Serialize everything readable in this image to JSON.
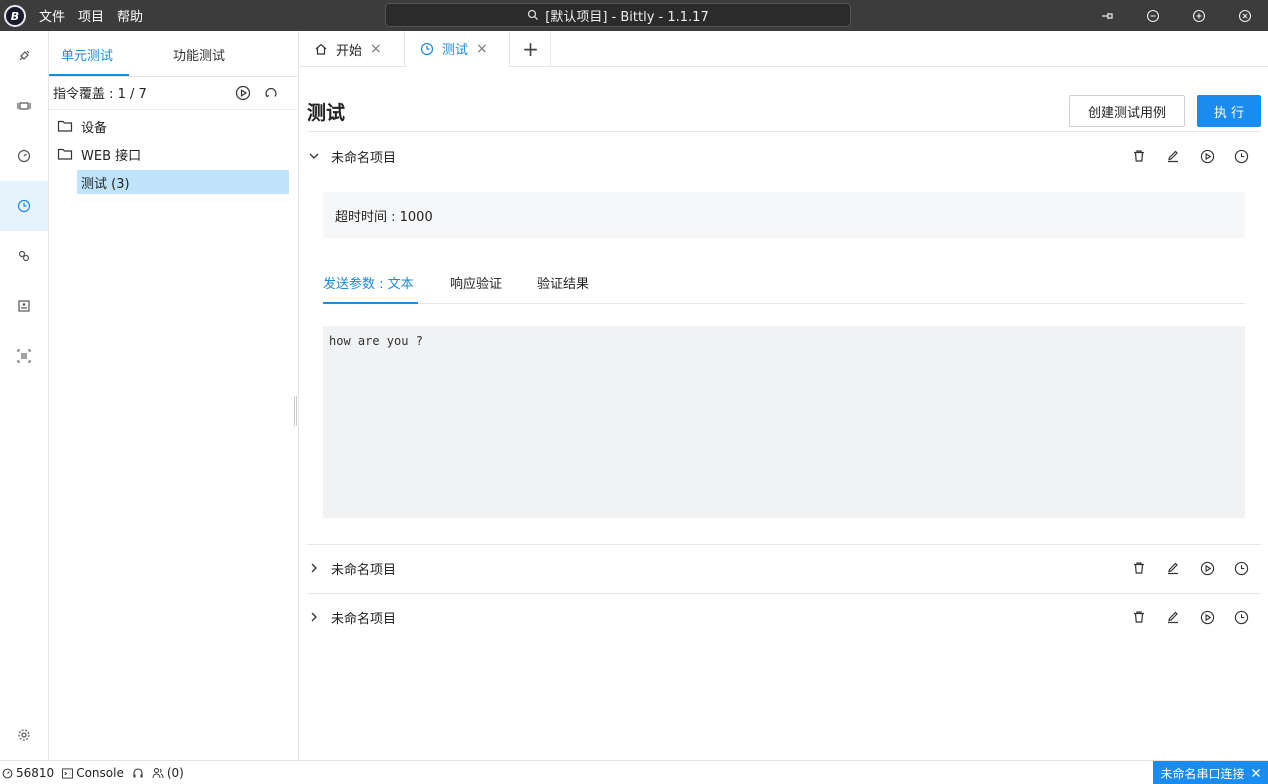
{
  "app": {
    "logo_text": "B",
    "menu": [
      "文件",
      "项目",
      "帮助"
    ],
    "search_title": "[默认项目] - Bittly - 1.1.17"
  },
  "sidebar": {
    "tabs": [
      "单元测试",
      "功能测试"
    ],
    "coverage": "指令覆盖 : 1 / 7",
    "tree": [
      {
        "label": "设备",
        "type": "folder"
      },
      {
        "label": "WEB 接口",
        "type": "folder"
      },
      {
        "label": "测试 (3)",
        "type": "leaf",
        "selected": true
      }
    ]
  },
  "editor": {
    "tabs": [
      {
        "label": "开始",
        "icon": "home-icon"
      },
      {
        "label": "测试",
        "icon": "clock-icon",
        "active": true
      }
    ]
  },
  "main": {
    "title": "测试",
    "create_label": "创建测试用例",
    "run_label": "执 行",
    "cases": [
      {
        "name": "未命名项目",
        "expanded": true
      },
      {
        "name": "未命名项目",
        "expanded": false
      },
      {
        "name": "未命名项目",
        "expanded": false
      }
    ],
    "timeout": "超时时间 : 1000",
    "inner_tabs": [
      "发送参数 : 文本",
      "响应验证",
      "验证结果"
    ],
    "payload": "how are you ?"
  },
  "status": {
    "port": "56810",
    "console": "Console",
    "audio": "",
    "users": "(0)",
    "connection": "未命名串口连接"
  },
  "colors": {
    "accent": "#1a8cdb",
    "primary_button": "#1a8cf0",
    "titlebar": "#3c3c3c"
  }
}
